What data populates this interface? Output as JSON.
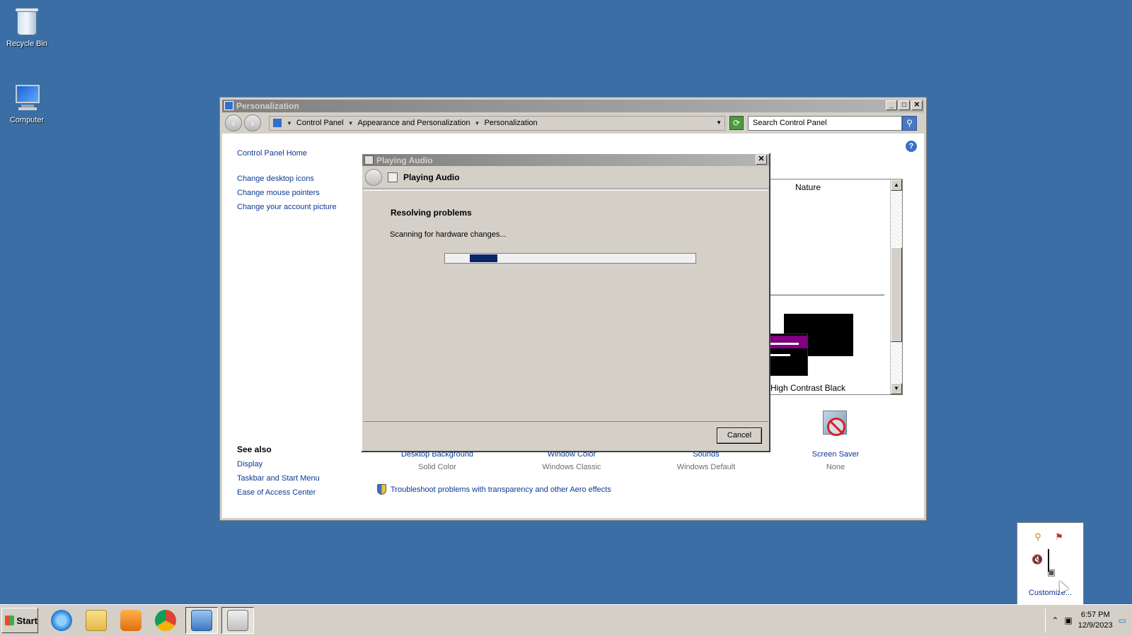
{
  "desktop": {
    "icons": [
      {
        "label": "Recycle Bin"
      },
      {
        "label": "Computer"
      }
    ]
  },
  "window": {
    "title": "Personalization",
    "buttons": {
      "minimize": "_",
      "maximize": "□",
      "close": "✕"
    },
    "breadcrumb": [
      "Control Panel",
      "Appearance and Personalization",
      "Personalization"
    ],
    "search_placeholder": "Search Control Panel",
    "left_pane": {
      "home": "Control Panel Home",
      "links": [
        "Change desktop icons",
        "Change mouse pointers",
        "Change your account picture"
      ]
    },
    "see_also": {
      "heading": "See also",
      "links": [
        "Display",
        "Taskbar and Start Menu",
        "Ease of Access Center"
      ]
    },
    "themes": {
      "top_theme": "Nature",
      "selected_theme": "High Contrast Black"
    },
    "settings": [
      {
        "name": "Desktop Background",
        "value": "Solid Color"
      },
      {
        "name": "Window Color",
        "value": "Windows Classic"
      },
      {
        "name": "Sounds",
        "value": "Windows Default"
      },
      {
        "name": "Screen Saver",
        "value": "None"
      }
    ],
    "troubleshoot_link": "Troubleshoot problems with transparency and other Aero effects"
  },
  "dialog": {
    "title": "Playing Audio",
    "header": "Playing Audio",
    "heading": "Resolving problems",
    "status": "Scanning for hardware changes...",
    "progress_position": 0.1,
    "progress_chunk_fraction": 0.11,
    "cancel_label": "Cancel"
  },
  "tray_popup": {
    "customize_label": "Customize..."
  },
  "taskbar": {
    "start_label": "Start",
    "apps": [
      "internet-explorer",
      "file-explorer",
      "media-player",
      "chrome",
      "control-panel",
      "troubleshooter"
    ],
    "clock_time": "6:57 PM",
    "clock_date": "12/9/2023"
  },
  "colors": {
    "desktop": "#3a6ea5",
    "link": "#0b3a94",
    "progress": "#0a246a",
    "classic_face": "#d4d0c8"
  }
}
